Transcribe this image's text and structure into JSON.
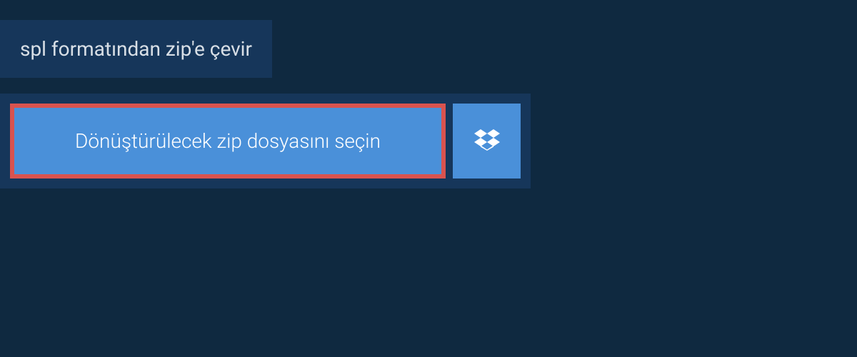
{
  "header": {
    "title": "spl formatından zip'e çevir"
  },
  "upload": {
    "select_button_label": "Dönüştürülecek zip dosyasını seçin",
    "dropbox_icon": "dropbox-icon"
  },
  "colors": {
    "background": "#0f2940",
    "panel": "#16365a",
    "button": "#4a90d9",
    "highlight_border": "#d9534f",
    "text_light": "#d8dfe6",
    "text_white": "#ffffff"
  }
}
